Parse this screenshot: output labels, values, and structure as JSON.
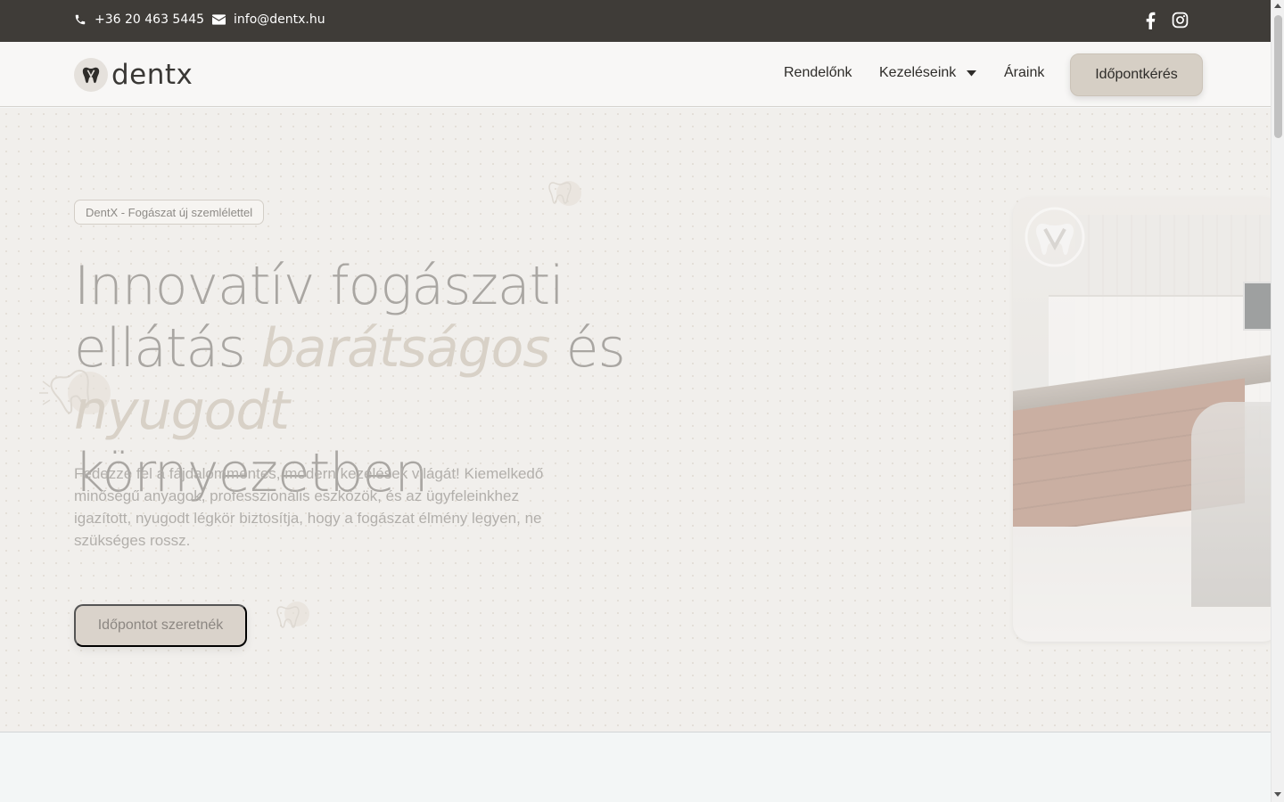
{
  "topbar": {
    "phone": "+36 20 463 5445",
    "email": "info@dentx.hu",
    "social": [
      "facebook-icon",
      "instagram-icon"
    ]
  },
  "header": {
    "logo_text": "dentx",
    "nav": {
      "rendelonk": "Rendelőnk",
      "kezeleseink": "Kezeléseink",
      "araink": "Áraink"
    },
    "cta": "Időpontkérés"
  },
  "hero": {
    "badge": "DentX - Fogászat új szemlélettel",
    "headline": {
      "line1": "Innovatív fogászati",
      "line2_a": "ellátás ",
      "line2_accent": "barátságos",
      "line2_b": " és",
      "line3_accent": "nyugodt",
      "line3_b": " környezetben"
    },
    "lead": "Fedezze fel a fájdalommentes, modern kezelések világát! Kiemelkedő minőségű anyagok, professzionális eszközök, és az ügyfeleinkhez igazított, nyugodt légkör biztosítja, hogy a fogászat élmény legyen, ne szükséges rossz.",
    "cta": "Időpontot szeretnék"
  },
  "colors": {
    "topbar_bg": "#3f3c38",
    "accent": "#d6cfc5",
    "hero_bg": "#f1efec"
  }
}
